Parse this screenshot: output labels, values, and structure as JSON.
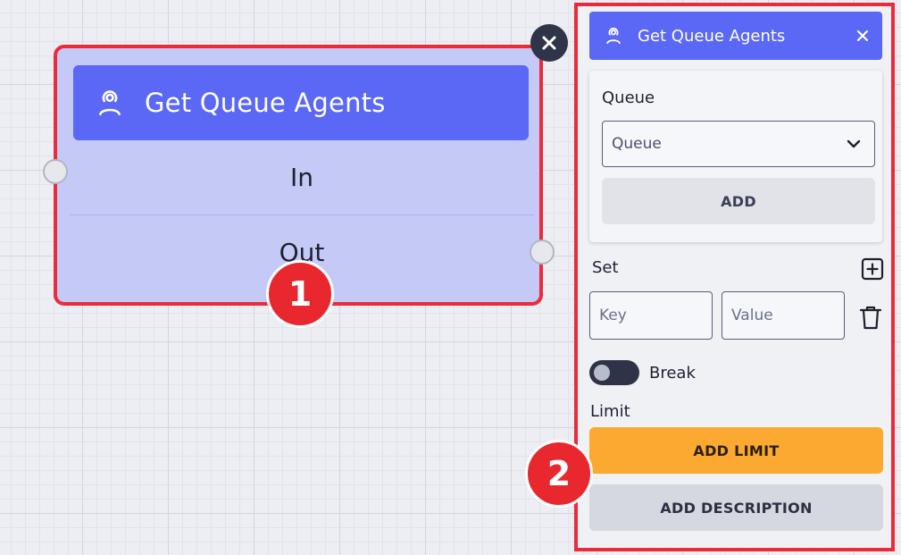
{
  "node": {
    "title": "Get Queue Agents",
    "input_label": "In",
    "output_label": "Out"
  },
  "badges": [
    "1",
    "2"
  ],
  "panel": {
    "title": "Get Queue Agents",
    "queue": {
      "label": "Queue",
      "selected": "Queue",
      "add_label": "ADD"
    },
    "set": {
      "label": "Set",
      "key_placeholder": "Key",
      "value_placeholder": "Value"
    },
    "break": {
      "label": "Break",
      "enabled": false
    },
    "limit": {
      "label": "Limit",
      "add_label": "ADD LIMIT"
    },
    "add_description_label": "ADD DESCRIPTION"
  },
  "colors": {
    "accent": "#5b68f5",
    "node_body": "#c5c9f6",
    "highlight": "#ec2b3a",
    "limit_button": "#fba930"
  },
  "icons": [
    "agent-icon",
    "close-icon",
    "chevron-down-icon",
    "plus-square-icon",
    "trash-icon"
  ]
}
